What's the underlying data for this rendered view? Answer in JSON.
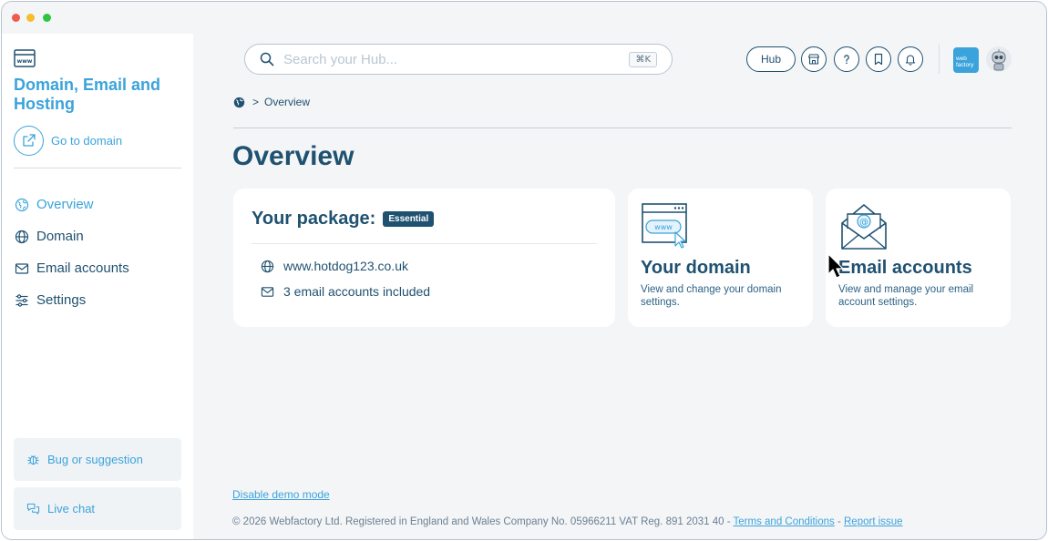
{
  "sidebar": {
    "section_title": "Domain, Email and Hosting",
    "goto_label": "Go to domain",
    "nav": [
      {
        "label": "Overview"
      },
      {
        "label": "Domain"
      },
      {
        "label": "Email accounts"
      },
      {
        "label": "Settings"
      }
    ],
    "bug_label": "Bug or suggestion",
    "chat_label": "Live chat"
  },
  "header": {
    "search_placeholder": "Search your Hub...",
    "search_shortcut": "⌘K",
    "hub_label": "Hub",
    "logo_text": "web factory"
  },
  "breadcrumb": {
    "current": "Overview"
  },
  "page_title": "Overview",
  "package": {
    "title": "Your package:",
    "badge": "Essential",
    "domain": "www.hotdog123.co.uk",
    "emails": "3 email accounts included"
  },
  "tiles": {
    "domain": {
      "title": "Your domain",
      "desc": "View and change your domain settings."
    },
    "email": {
      "title": "Email accounts",
      "desc": "View and manage your email account settings."
    }
  },
  "footer": {
    "demo_link": "Disable demo mode",
    "copyright": "© 2026 Webfactory Ltd. Registered in England and Wales Company No. 05966211 VAT Reg. 891 2031 40 - ",
    "terms": "Terms and Conditions",
    "dash": " - ",
    "report": "Report issue"
  },
  "colors": {
    "accent": "#3ba3db",
    "navy": "#1f5170",
    "background": "#f4f5f7"
  }
}
